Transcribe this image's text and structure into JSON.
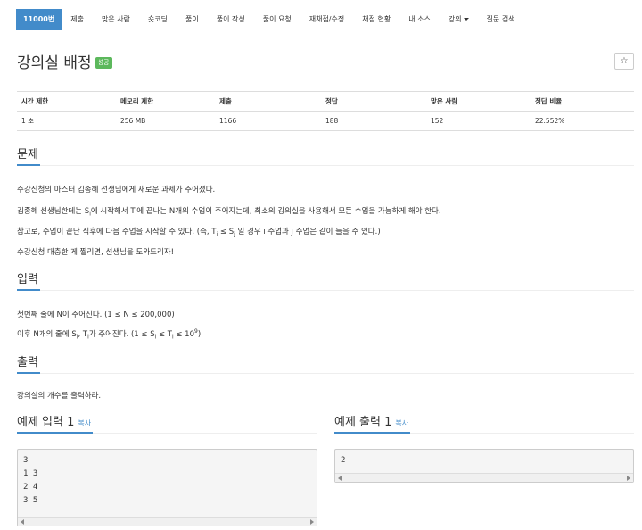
{
  "nav": {
    "items": [
      {
        "label": "11000번",
        "active": true
      },
      {
        "label": "제출"
      },
      {
        "label": "맞은 사람"
      },
      {
        "label": "숏코딩"
      },
      {
        "label": "풀이"
      },
      {
        "label": "풀이 작성"
      },
      {
        "label": "풀이 요청"
      },
      {
        "label": "재채점/수정"
      },
      {
        "label": "채점 현황"
      },
      {
        "label": "내 소스"
      },
      {
        "label": "강의",
        "dropdown": true
      },
      {
        "label": "질문 검색"
      }
    ]
  },
  "problem": {
    "title": "강의실 배정",
    "badge": "성공",
    "star": "☆"
  },
  "stats": {
    "headers": [
      "시간 제한",
      "메모리 제한",
      "제출",
      "정답",
      "맞은 사람",
      "정답 비율"
    ],
    "values": [
      "1 초",
      "256 MB",
      "1166",
      "188",
      "152",
      "22.552%"
    ]
  },
  "sections": {
    "problem_label": "문제",
    "input_label": "입력",
    "output_label": "출력",
    "sample_input_label": "예제 입력 1",
    "sample_output_label": "예제 출력 1",
    "copy_label": "복사"
  },
  "body": {
    "p1": "수강신청의 마스터 김종혜 선생님에게 새로운 과제가 주어졌다.",
    "p2_a": "김종혜 선생님한테는 S",
    "p2_sub1": "i",
    "p2_b": "에 시작해서 T",
    "p2_sub2": "i",
    "p2_c": "에 끝나는 N개의 수업이 주어지는데, 최소의 강의실을 사용해서 모든 수업을 가능하게 해야 한다.",
    "p3_a": "참고로, 수업이 끝난 직후에 다음 수업을 시작할 수 있다. (즉, T",
    "p3_sub1": "i",
    "p3_b": " ≤ S",
    "p3_sub2": "j",
    "p3_c": " 일 경우 i 수업과 j 수업은 같이 들을 수 있다.)",
    "p4": "수강신청 대충한 게 찔리면, 선생님을 도와드리자!"
  },
  "input": {
    "l1": "첫번째 줄에 N이 주어진다. (1 ≤ N ≤ 200,000)",
    "l2_a": "이후 N개의 줄에 S",
    "l2_sub1": "i",
    "l2_b": ", T",
    "l2_sub2": "i",
    "l2_c": "가 주어진다. (1 ≤ S",
    "l2_sub3": "i",
    "l2_d": " ≤ T",
    "l2_sub4": "i",
    "l2_e": " ≤ 10",
    "l2_sup": "9",
    "l2_f": ")"
  },
  "output": {
    "l1": "강의실의 개수를 출력하라."
  },
  "samples": {
    "input_lines": [
      "3",
      "1 3",
      "2 4",
      "3 5"
    ],
    "output_lines": [
      "2"
    ]
  }
}
